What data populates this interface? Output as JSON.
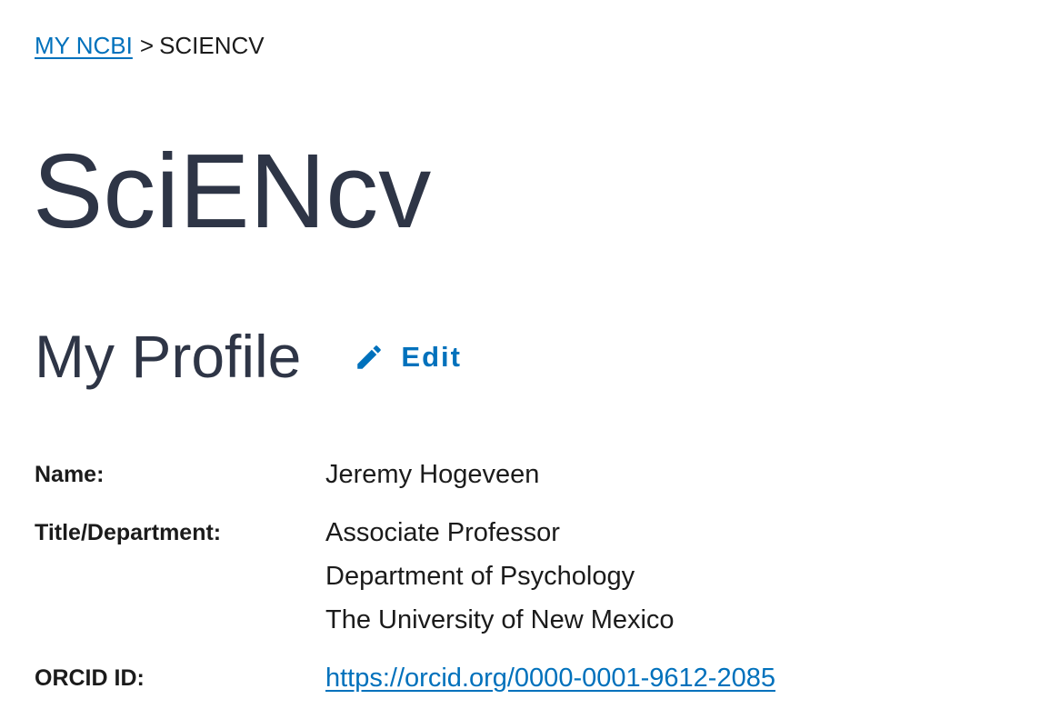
{
  "breadcrumb": {
    "parent": "MY NCBI",
    "separator": ">",
    "current": "SCIENCV"
  },
  "app": {
    "title": "SciENcv"
  },
  "profile_section": {
    "title": "My Profile",
    "edit_label": "Edit",
    "edit_icon": "pencil-icon"
  },
  "profile": {
    "name_label": "Name:",
    "name_value": "Jeremy Hogeveen",
    "title_label": "Title/Department:",
    "title_lines": [
      "Associate Professor",
      "Department of Psychology",
      "The University of New Mexico"
    ],
    "orcid_label": "ORCID ID:",
    "orcid_value": "https://orcid.org/0000-0001-9612-2085"
  },
  "colors": {
    "link": "#0071bc",
    "heading": "#2e3546",
    "text": "#1b1b1b"
  }
}
